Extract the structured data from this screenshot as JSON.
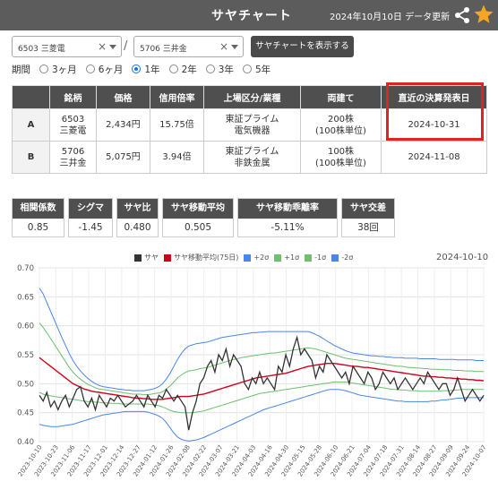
{
  "header": {
    "title": "サヤチャート",
    "updated": "2024年10月10日 データ更新",
    "share_icon": "share-icon",
    "star_icon": "star-icon",
    "star_color": "#f5a623"
  },
  "selector": {
    "stock1": "6503 三菱電",
    "stock2": "5706 三井金",
    "clear": "×",
    "slash": "/",
    "show_button": "サヤチャートを表示する"
  },
  "period": {
    "label": "期間",
    "options": [
      "3ヶ月",
      "6ヶ月",
      "1年",
      "2年",
      "3年",
      "5年"
    ],
    "selected": "1年"
  },
  "table": {
    "headers": [
      "銘柄",
      "価格",
      "信用倍率",
      "上場区分/業種",
      "両建て",
      "直近の決算発表日"
    ],
    "rows": [
      {
        "label": "A",
        "code": "6503",
        "name": "三菱電",
        "price": "2,434円",
        "ratio": "15.75倍",
        "market": "東証プライム",
        "sector": "電気機器",
        "hedge": "200株",
        "unit": "(100株単位)",
        "earnings": "2024-10-31"
      },
      {
        "label": "B",
        "code": "5706",
        "name": "三井金",
        "price": "5,075円",
        "ratio": "3.94倍",
        "market": "東証プライム",
        "sector": "非鉄金属",
        "hedge": "100株",
        "unit": "(100株単位)",
        "earnings": "2024-11-08"
      }
    ],
    "highlight_color": "#e02424"
  },
  "stats": [
    {
      "label": "相関係数",
      "value": "0.85"
    },
    {
      "label": "シグマ",
      "value": "-1.45"
    },
    {
      "label": "サヤ比",
      "value": "0.480"
    },
    {
      "label": "サヤ移動平均",
      "value": "0.505"
    },
    {
      "label": "サヤ移動乖離率",
      "value": "-5.11%"
    },
    {
      "label": "サヤ交差",
      "value": "38回"
    }
  ],
  "chart_data": {
    "type": "line",
    "date_label": "2024-10-10",
    "ylim": [
      0.4,
      0.7
    ],
    "yticks": [
      "0.70",
      "0.65",
      "0.60",
      "0.55",
      "0.50",
      "0.45",
      "0.40"
    ],
    "xticks": [
      "2023-10-10",
      "2023-10-23",
      "2023-11-06",
      "2023-11-17",
      "2023-12-01",
      "2023-12-14",
      "2023-12-27",
      "2024-01-12",
      "2024-01-26",
      "2024-02-08",
      "2024-02-22",
      "2024-03-07",
      "2024-03-21",
      "2024-04-03",
      "2024-04-16",
      "2024-04-30",
      "2024-05-15",
      "2024-05-28",
      "2024-06-10",
      "2024-06-21",
      "2024-07-04",
      "2024-07-18",
      "2024-07-31",
      "2024-08-14",
      "2024-08-27",
      "2024-09-09",
      "2024-09-24",
      "2024-10-07"
    ],
    "series": [
      {
        "name": "サヤ",
        "color": "#333333",
        "values": [
          0.48,
          0.47,
          0.485,
          0.46,
          0.47,
          0.455,
          0.47,
          0.48,
          0.46,
          0.475,
          0.49,
          0.495,
          0.47,
          0.46,
          0.475,
          0.455,
          0.48,
          0.47,
          0.46,
          0.475,
          0.47,
          0.48,
          0.47,
          0.46,
          0.465,
          0.47,
          0.48,
          0.47,
          0.46,
          0.48,
          0.47,
          0.46,
          0.48,
          0.475,
          0.49,
          0.48,
          0.47,
          0.48,
          0.47,
          0.46,
          0.42,
          0.45,
          0.47,
          0.5,
          0.51,
          0.53,
          0.54,
          0.52,
          0.55,
          0.54,
          0.56,
          0.53,
          0.55,
          0.54,
          0.53,
          0.5,
          0.49,
          0.51,
          0.5,
          0.52,
          0.5,
          0.51,
          0.5,
          0.49,
          0.53,
          0.52,
          0.55,
          0.53,
          0.56,
          0.58,
          0.55,
          0.56,
          0.55,
          0.54,
          0.51,
          0.53,
          0.52,
          0.55,
          0.54,
          0.53,
          0.52,
          0.51,
          0.52,
          0.5,
          0.53,
          0.52,
          0.51,
          0.5,
          0.52,
          0.51,
          0.49,
          0.5,
          0.52,
          0.51,
          0.5,
          0.51,
          0.49,
          0.5,
          0.51,
          0.5,
          0.49,
          0.5,
          0.51,
          0.5,
          0.52,
          0.51,
          0.5,
          0.49,
          0.5,
          0.5,
          0.48,
          0.49,
          0.51,
          0.49,
          0.47,
          0.48,
          0.49,
          0.48,
          0.47,
          0.48
        ]
      },
      {
        "name": "サヤ移動平均(75日)",
        "color": "#d0021b",
        "values": [
          0.545,
          0.54,
          0.535,
          0.53,
          0.525,
          0.52,
          0.515,
          0.51,
          0.505,
          0.5,
          0.497,
          0.494,
          0.491,
          0.489,
          0.487,
          0.486,
          0.485,
          0.484,
          0.483,
          0.482,
          0.481,
          0.48,
          0.479,
          0.478,
          0.477,
          0.476,
          0.475,
          0.475,
          0.474,
          0.474,
          0.473,
          0.473,
          0.473,
          0.473,
          0.474,
          0.475,
          0.476,
          0.477,
          0.478,
          0.478,
          0.478,
          0.479,
          0.48,
          0.481,
          0.482,
          0.484,
          0.486,
          0.488,
          0.49,
          0.492,
          0.494,
          0.496,
          0.498,
          0.5,
          0.502,
          0.504,
          0.506,
          0.508,
          0.51,
          0.511,
          0.512,
          0.513,
          0.514,
          0.515,
          0.516,
          0.517,
          0.518,
          0.52,
          0.522,
          0.524,
          0.526,
          0.528,
          0.53,
          0.531,
          0.532,
          0.533,
          0.534,
          0.535,
          0.535,
          0.535,
          0.534,
          0.533,
          0.532,
          0.531,
          0.53,
          0.53,
          0.529,
          0.528,
          0.528,
          0.527,
          0.526,
          0.525,
          0.524,
          0.523,
          0.522,
          0.521,
          0.52,
          0.519,
          0.518,
          0.517,
          0.516,
          0.515,
          0.514,
          0.513,
          0.513,
          0.512,
          0.512,
          0.511,
          0.511,
          0.51,
          0.51,
          0.509,
          0.509,
          0.508,
          0.508,
          0.507,
          0.507,
          0.506,
          0.506,
          0.505
        ]
      },
      {
        "name": "+2σ",
        "color": "#4a86e8",
        "values": [
          0.665,
          0.655,
          0.64,
          0.625,
          0.61,
          0.595,
          0.58,
          0.566,
          0.552,
          0.54,
          0.53,
          0.522,
          0.515,
          0.509,
          0.504,
          0.5,
          0.497,
          0.495,
          0.494,
          0.493,
          0.492,
          0.491,
          0.49,
          0.489,
          0.489,
          0.488,
          0.488,
          0.488,
          0.488,
          0.489,
          0.49,
          0.492,
          0.495,
          0.5,
          0.508,
          0.518,
          0.53,
          0.542,
          0.552,
          0.56,
          0.565,
          0.567,
          0.569,
          0.57,
          0.571,
          0.572,
          0.574,
          0.576,
          0.578,
          0.58,
          0.581,
          0.582,
          0.583,
          0.584,
          0.585,
          0.586,
          0.587,
          0.588,
          0.588,
          0.589,
          0.589,
          0.59,
          0.59,
          0.59,
          0.59,
          0.59,
          0.59,
          0.59,
          0.59,
          0.59,
          0.59,
          0.59,
          0.59,
          0.588,
          0.585,
          0.582,
          0.578,
          0.574,
          0.57,
          0.566,
          0.563,
          0.56,
          0.557,
          0.555,
          0.553,
          0.552,
          0.551,
          0.55,
          0.549,
          0.548,
          0.548,
          0.547,
          0.547,
          0.546,
          0.546,
          0.545,
          0.545,
          0.545,
          0.544,
          0.544,
          0.544,
          0.544,
          0.543,
          0.543,
          0.543,
          0.543,
          0.543,
          0.542,
          0.542,
          0.542,
          0.542,
          0.542,
          0.541,
          0.541,
          0.541,
          0.541,
          0.541,
          0.54,
          0.54,
          0.54
        ]
      },
      {
        "name": "+1σ",
        "color": "#6fbf6f",
        "values": [
          0.605,
          0.597,
          0.588,
          0.578,
          0.568,
          0.558,
          0.548,
          0.538,
          0.528,
          0.52,
          0.513,
          0.508,
          0.503,
          0.499,
          0.496,
          0.493,
          0.491,
          0.49,
          0.489,
          0.488,
          0.487,
          0.486,
          0.485,
          0.484,
          0.483,
          0.482,
          0.482,
          0.482,
          0.481,
          0.481,
          0.482,
          0.483,
          0.484,
          0.486,
          0.491,
          0.496,
          0.503,
          0.51,
          0.515,
          0.519,
          0.522,
          0.523,
          0.524,
          0.526,
          0.527,
          0.528,
          0.53,
          0.532,
          0.534,
          0.536,
          0.538,
          0.54,
          0.542,
          0.543,
          0.545,
          0.546,
          0.547,
          0.548,
          0.549,
          0.55,
          0.551,
          0.552,
          0.553,
          0.553,
          0.554,
          0.555,
          0.556,
          0.557,
          0.558,
          0.559,
          0.56,
          0.561,
          0.562,
          0.561,
          0.56,
          0.558,
          0.556,
          0.554,
          0.552,
          0.55,
          0.548,
          0.546,
          0.544,
          0.543,
          0.542,
          0.541,
          0.54,
          0.539,
          0.538,
          0.537,
          0.536,
          0.535,
          0.534,
          0.533,
          0.532,
          0.531,
          0.53,
          0.53,
          0.529,
          0.528,
          0.528,
          0.527,
          0.527,
          0.526,
          0.526,
          0.525,
          0.525,
          0.525,
          0.524,
          0.524,
          0.524,
          0.523,
          0.523,
          0.523,
          0.522,
          0.522,
          0.522,
          0.521,
          0.521,
          0.521
        ]
      },
      {
        "name": "-1σ",
        "color": "#6fbf6f",
        "values": [
          0.485,
          0.482,
          0.48,
          0.479,
          0.478,
          0.477,
          0.476,
          0.475,
          0.474,
          0.473,
          0.472,
          0.471,
          0.47,
          0.469,
          0.469,
          0.468,
          0.468,
          0.467,
          0.467,
          0.466,
          0.466,
          0.466,
          0.465,
          0.465,
          0.465,
          0.465,
          0.465,
          0.465,
          0.465,
          0.465,
          0.464,
          0.463,
          0.462,
          0.46,
          0.457,
          0.454,
          0.452,
          0.451,
          0.45,
          0.45,
          0.45,
          0.45,
          0.451,
          0.452,
          0.453,
          0.455,
          0.457,
          0.459,
          0.461,
          0.463,
          0.465,
          0.467,
          0.469,
          0.471,
          0.473,
          0.475,
          0.477,
          0.479,
          0.481,
          0.483,
          0.484,
          0.485,
          0.486,
          0.487,
          0.488,
          0.489,
          0.49,
          0.491,
          0.492,
          0.493,
          0.494,
          0.495,
          0.496,
          0.497,
          0.498,
          0.499,
          0.5,
          0.501,
          0.502,
          0.503,
          0.503,
          0.503,
          0.503,
          0.502,
          0.501,
          0.5,
          0.499,
          0.498,
          0.497,
          0.496,
          0.495,
          0.494,
          0.493,
          0.492,
          0.491,
          0.49,
          0.49,
          0.489,
          0.489,
          0.488,
          0.488,
          0.488,
          0.487,
          0.487,
          0.487,
          0.487,
          0.487,
          0.487,
          0.488,
          0.488,
          0.488,
          0.489,
          0.489,
          0.49,
          0.49,
          0.49,
          0.49,
          0.49,
          0.49,
          0.49
        ]
      },
      {
        "name": "-2σ",
        "color": "#4a86e8",
        "values": [
          0.43,
          0.428,
          0.427,
          0.426,
          0.426,
          0.426,
          0.427,
          0.428,
          0.429,
          0.43,
          0.432,
          0.434,
          0.436,
          0.438,
          0.44,
          0.442,
          0.444,
          0.446,
          0.447,
          0.448,
          0.449,
          0.45,
          0.451,
          0.452,
          0.452,
          0.452,
          0.452,
          0.452,
          0.452,
          0.451,
          0.449,
          0.447,
          0.444,
          0.44,
          0.433,
          0.424,
          0.415,
          0.408,
          0.404,
          0.402,
          0.401,
          0.402,
          0.403,
          0.405,
          0.407,
          0.41,
          0.413,
          0.416,
          0.419,
          0.422,
          0.425,
          0.428,
          0.431,
          0.434,
          0.437,
          0.44,
          0.443,
          0.446,
          0.449,
          0.452,
          0.455,
          0.457,
          0.459,
          0.461,
          0.463,
          0.465,
          0.467,
          0.469,
          0.471,
          0.473,
          0.475,
          0.477,
          0.479,
          0.481,
          0.483,
          0.485,
          0.487,
          0.489,
          0.49,
          0.49,
          0.49,
          0.489,
          0.488,
          0.486,
          0.484,
          0.482,
          0.48,
          0.479,
          0.478,
          0.477,
          0.476,
          0.475,
          0.474,
          0.473,
          0.472,
          0.471,
          0.47,
          0.47,
          0.469,
          0.469,
          0.469,
          0.469,
          0.469,
          0.469,
          0.469,
          0.47,
          0.47,
          0.471,
          0.472,
          0.472,
          0.473,
          0.474,
          0.475,
          0.475,
          0.476,
          0.476,
          0.476,
          0.476,
          0.476,
          0.476
        ]
      }
    ]
  }
}
